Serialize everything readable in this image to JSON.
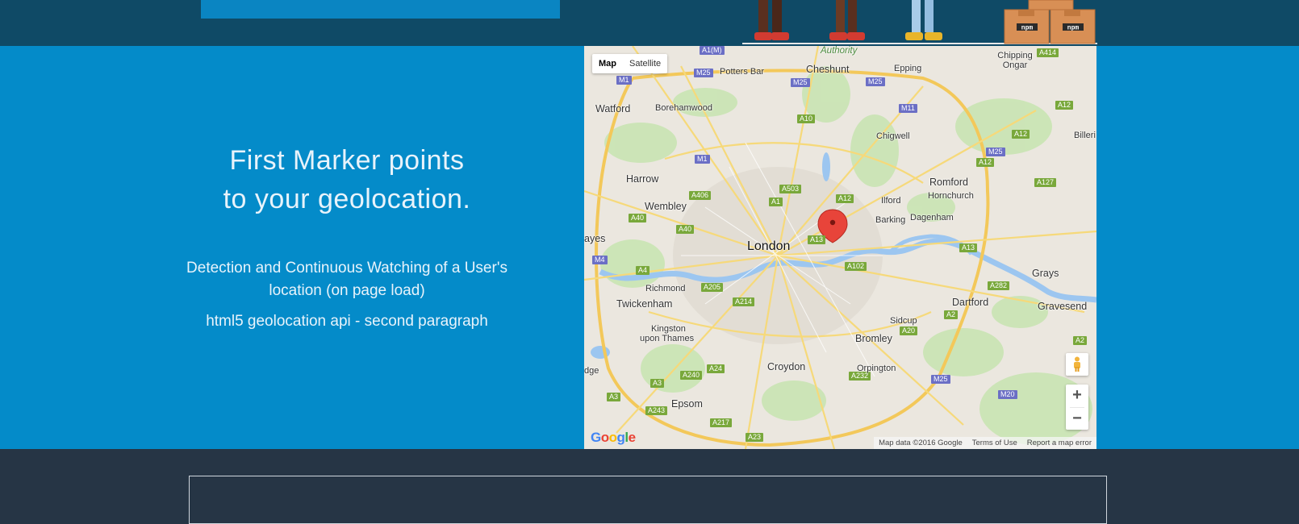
{
  "feature": {
    "heading_line1": "First Marker points",
    "heading_line2": "to your geolocation.",
    "paragraph1": "Detection and Continuous Watching of a User's location (on page load)",
    "paragraph2": "html5 geolocation api - second paragraph"
  },
  "colors": {
    "top_band": "#0f4a66",
    "feature_bg": "#048bc9",
    "footer_bg": "#263545",
    "marker": "#e8443a"
  },
  "map": {
    "map_type": {
      "map": "Map",
      "satellite": "Satellite",
      "selected": "Map"
    },
    "places": {
      "london": "London",
      "watford": "Watford",
      "borehamwood": "Borehamwood",
      "potters_bar": "Potters Bar",
      "cheshunt": "Cheshunt",
      "epping": "Epping",
      "chipping_ongar": "Chipping Ongar",
      "chigwell": "Chigwell",
      "harrow": "Harrow",
      "wembley": "Wembley",
      "romford": "Romford",
      "hornchurch": "Hornchurch",
      "ilford": "Ilford",
      "barking": "Barking",
      "dagenham": "Dagenham",
      "hayes": "ayes",
      "richmond": "Richmond",
      "twickenham": "Twickenham",
      "kingston": "Kingston",
      "upon_thames": "upon Thames",
      "croydon": "Croydon",
      "bromley": "Bromley",
      "sidcup": "Sidcup",
      "orpington": "Orpington",
      "dartford": "Dartford",
      "grays": "Grays",
      "gravesend": "Gravesend",
      "epsom": "Epsom",
      "billericay": "Billeri",
      "edge": "dge",
      "authority": "Authority"
    },
    "roads": {
      "a1m": "A1(M)",
      "m25a": "M25",
      "m25b": "M25",
      "m25c": "M25",
      "m25d": "M25",
      "m1a": "M1",
      "m1b": "M1",
      "a414": "A414",
      "a10": "A10",
      "m11": "M11",
      "a12a": "A12",
      "a12b": "A12",
      "a12c": "A12",
      "a12d": "A12",
      "a503": "A503",
      "a406": "A406",
      "a1": "A1",
      "a40a": "A40",
      "a40b": "A40",
      "a13a": "A13",
      "a13b": "A13",
      "a127": "A127",
      "m4": "M4",
      "a4": "A4",
      "a205": "A205",
      "a102": "A102",
      "a282": "A282",
      "a2a": "A2",
      "a2b": "A2",
      "a20": "A20",
      "a214": "A214",
      "a240": "A240",
      "a24": "A24",
      "a232": "A232",
      "m25e": "M25",
      "m20": "M20",
      "a3a": "A3",
      "a3b": "A3",
      "a243": "A243",
      "a217": "A217",
      "a23": "A23"
    },
    "zoom_in": "+",
    "zoom_out": "−",
    "attribution": {
      "data": "Map data ©2016 Google",
      "terms": "Terms of Use",
      "report": "Report a map error"
    },
    "logo": {
      "g1": "G",
      "o1": "o",
      "o2": "o",
      "g2": "g",
      "l": "l",
      "e": "e"
    }
  },
  "npm_boxes": {
    "label1": "npm",
    "label2": "npm"
  }
}
